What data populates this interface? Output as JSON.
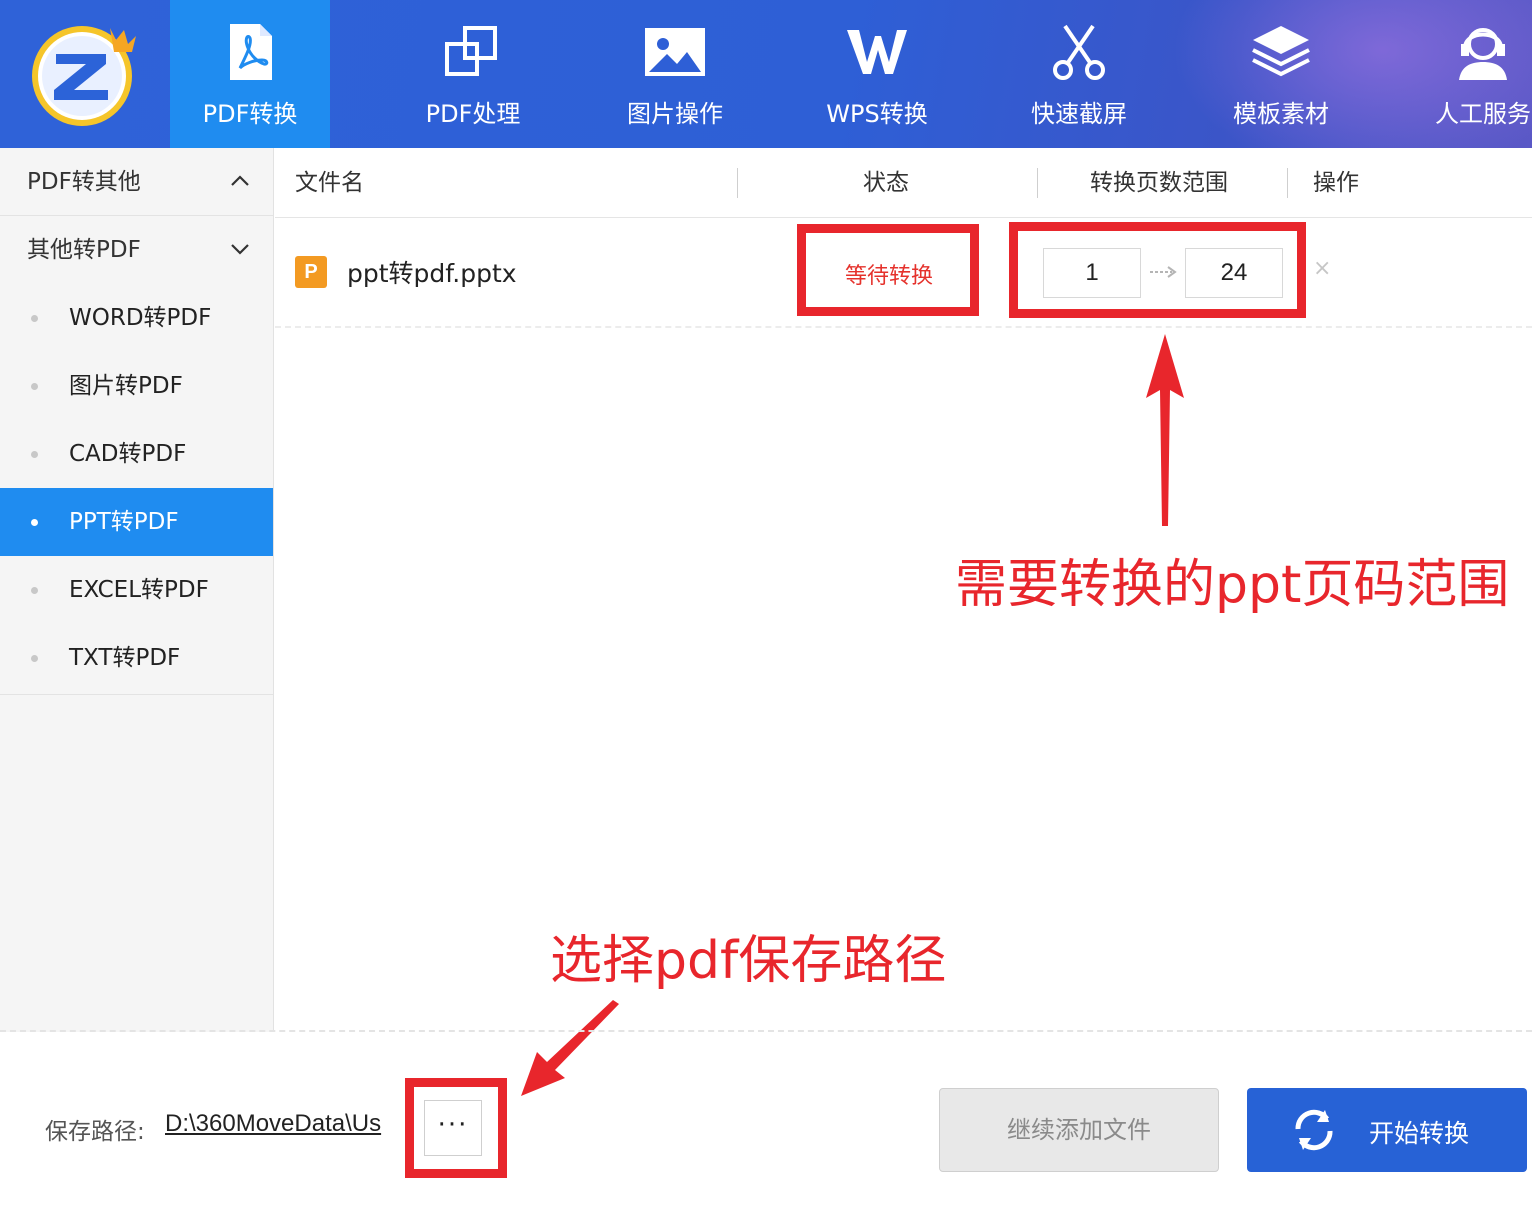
{
  "colors": {
    "nav_bg": "#2e5fd6",
    "active_blue": "#1f8cf0",
    "annotation_red": "#e8262c",
    "status_red": "#e5322c",
    "start_button": "#2762d6"
  },
  "logo": {
    "icon": "z-logo-with-crown",
    "letter": "Z"
  },
  "nav": {
    "items": [
      {
        "label": "PDF转换",
        "icon": "pdf-icon",
        "active": true
      },
      {
        "label": "PDF处理",
        "icon": "overlap-squares-icon"
      },
      {
        "label": "图片操作",
        "icon": "image-icon"
      },
      {
        "label": "WPS转换",
        "icon": "wps-icon"
      },
      {
        "label": "快速截屏",
        "icon": "scissors-icon"
      },
      {
        "label": "模板素材",
        "icon": "layers-icon"
      },
      {
        "label": "人工服务",
        "icon": "support-agent-icon"
      }
    ]
  },
  "sidebar": {
    "group1": {
      "label": "PDF转其他",
      "icon": "chevron-up-icon"
    },
    "group2": {
      "label": "其他转PDF",
      "icon": "chevron-down-icon"
    },
    "items": [
      {
        "label": "WORD转PDF"
      },
      {
        "label": "图片转PDF"
      },
      {
        "label": "CAD转PDF"
      },
      {
        "label": "PPT转PDF",
        "active": true
      },
      {
        "label": "EXCEL转PDF"
      },
      {
        "label": "TXT转PDF"
      }
    ]
  },
  "table": {
    "headers": {
      "filename": "文件名",
      "status": "状态",
      "range": "转换页数范围",
      "action": "操作"
    },
    "rows": [
      {
        "file_icon_letter": "P",
        "filename": "ppt转pdf.pptx",
        "status": "等待转换",
        "page_from": "1",
        "page_to": "24",
        "delete": "×"
      }
    ]
  },
  "annotations": {
    "range_note": "需要转换的ppt页码范围",
    "path_note": "选择pdf保存路径"
  },
  "footer": {
    "save_label": "保存路径:",
    "save_path": "D:\\360MoveData\\Us",
    "browse_label": "···",
    "add_button": "继续添加文件",
    "start_button": "开始转换"
  }
}
